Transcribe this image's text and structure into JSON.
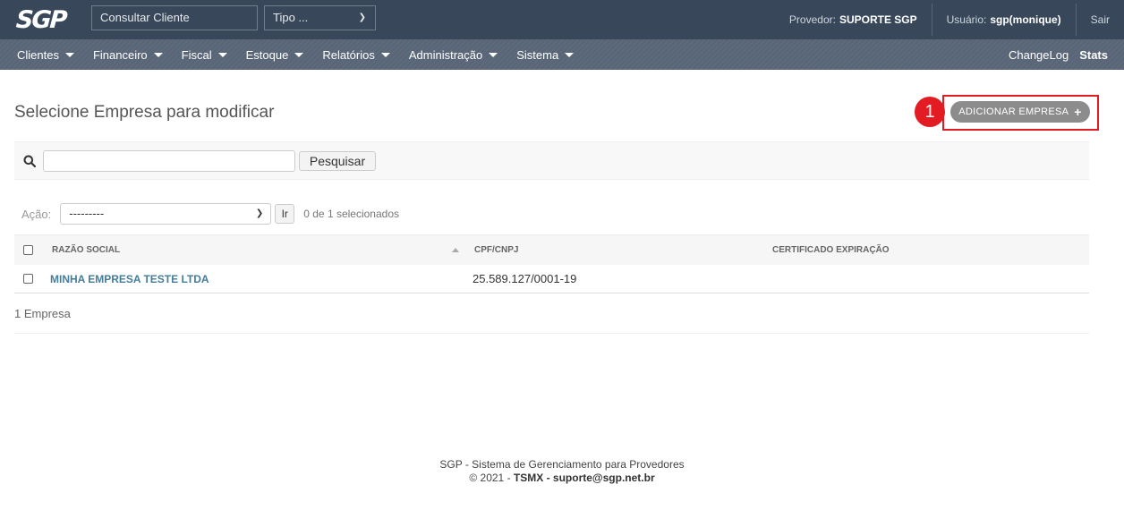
{
  "header": {
    "logo": "SGP",
    "consult_value": "Consultar Cliente",
    "tipo_value": "Tipo ...",
    "provider_label": "Provedor:",
    "provider_name": "SUPORTE SGP",
    "user_label": "Usuário:",
    "user_name": "sgp(monique)",
    "logout": "Sair"
  },
  "nav": {
    "items": [
      {
        "label": "Clientes"
      },
      {
        "label": "Financeiro"
      },
      {
        "label": "Fiscal"
      },
      {
        "label": "Estoque"
      },
      {
        "label": "Relatórios"
      },
      {
        "label": "Administração"
      },
      {
        "label": "Sistema"
      }
    ],
    "changelog": "ChangeLog",
    "stats": "Stats"
  },
  "page": {
    "title": "Selecione Empresa para modificar",
    "add_button": "ADICIONAR EMPRESA",
    "callout_number": "1"
  },
  "search": {
    "value": "",
    "button": "Pesquisar"
  },
  "actions": {
    "label": "Ação:",
    "selected_value": "---------",
    "go_button": "Ir",
    "selected_count": "0 de 1 selecionados"
  },
  "table": {
    "columns": [
      "RAZÃO SOCIAL",
      "CPF/CNPJ",
      "CERTIFICADO EXPIRAÇÃO"
    ],
    "rows": [
      {
        "razao_social": "MINHA EMPRESA TESTE LTDA",
        "cpf_cnpj": "25.589.127/0001-19",
        "certificado": ""
      }
    ],
    "count_text": "1 Empresa"
  },
  "footer": {
    "line1": "SGP - Sistema de Gerenciamento para Provedores",
    "line2_prefix": "© 2021 -",
    "line2_bold": "TSMX - suporte@sgp.net.br"
  },
  "colors": {
    "header_bg": "#38485a",
    "nav_bg": "#5a6778",
    "link": "#447e9b",
    "highlight": "#e31b23"
  }
}
